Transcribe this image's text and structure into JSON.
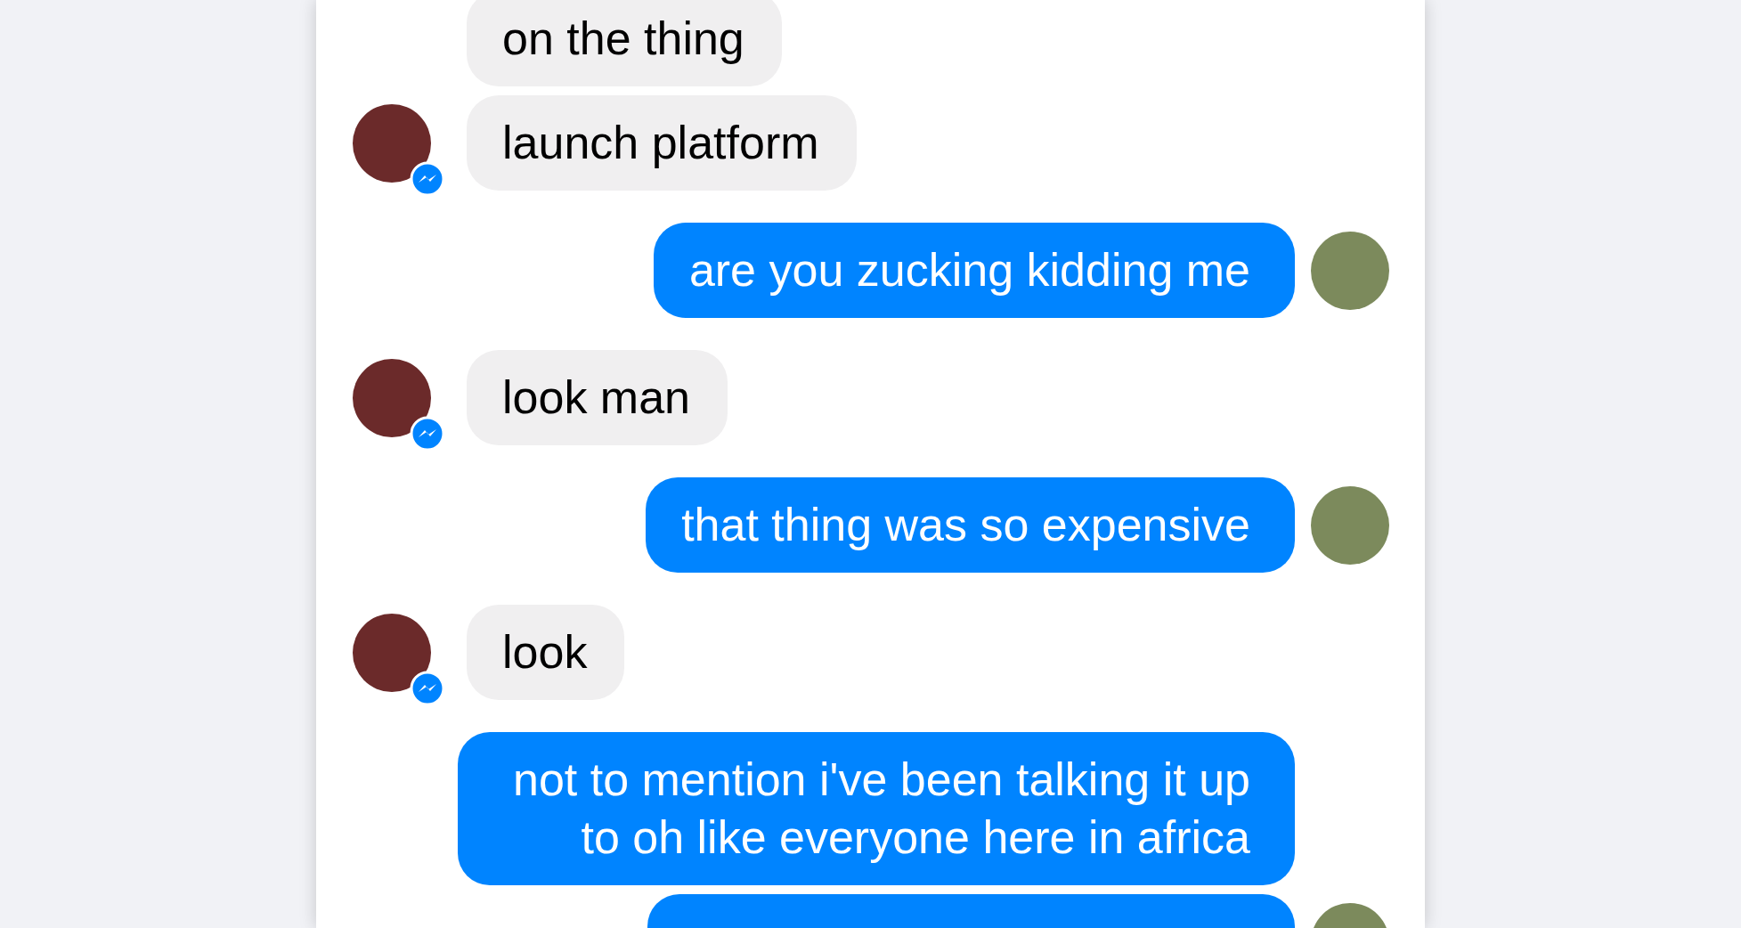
{
  "messages": [
    {
      "kind": "incoming",
      "text": "on the thing",
      "avatar": false
    },
    {
      "kind": "incoming",
      "text": "launch platform",
      "avatar": true
    },
    {
      "kind": "outgoing",
      "text": "are you zucking kidding me",
      "avatar": true
    },
    {
      "kind": "incoming",
      "text": "look man",
      "avatar": true
    },
    {
      "kind": "outgoing",
      "text": "that thing was so expensive",
      "avatar": true
    },
    {
      "kind": "incoming",
      "text": "look",
      "avatar": true
    },
    {
      "kind": "outgoing",
      "text": "not to mention i've been talking it up to oh like everyone here in africa",
      "avatar": false
    },
    {
      "kind": "outgoing",
      "avatar": true
    }
  ]
}
